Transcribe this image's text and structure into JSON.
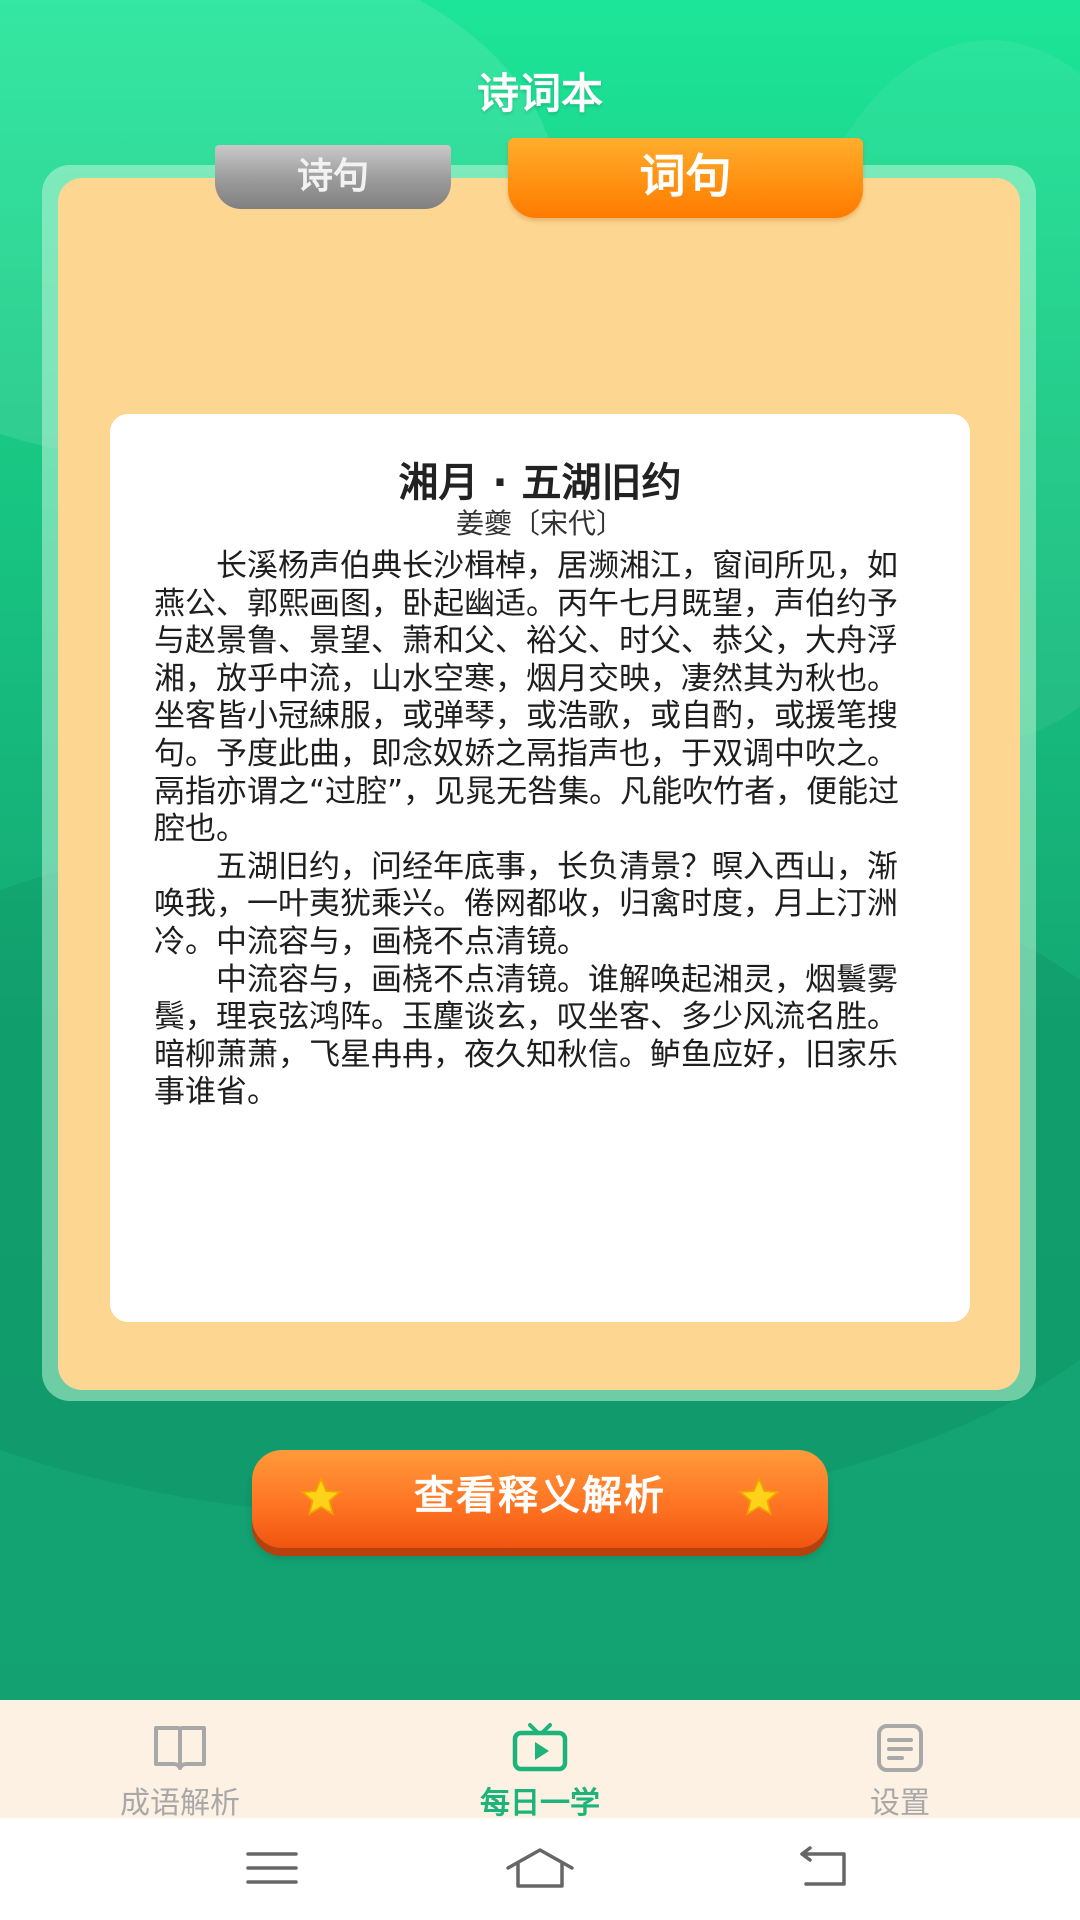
{
  "app": {
    "title": "诗词本"
  },
  "tabs": [
    {
      "label": "诗句",
      "active": false
    },
    {
      "label": "词句",
      "active": true
    }
  ],
  "poem": {
    "title": "湘月 · 五湖旧约",
    "author": "姜夔〔宋代〕",
    "paragraphs": [
      "长溪杨声伯典长沙楫棹，居濒湘江，窗间所见，如燕公、郭熙画图，卧起幽适。丙午七月既望，声伯约予与赵景鲁、景望、萧和父、裕父、时父、恭父，大舟浮湘，放乎中流，山水空寒，烟月交映，凄然其为秋也。坐客皆小冠綀服，或弹琴，或浩歌，或自酌，或援笔搜句。予度此曲，即念奴娇之鬲指声也，于双调中吹之。鬲指亦谓之“过腔”，见晁无咎集。凡能吹竹者，便能过腔也。",
      "五湖旧约，问经年底事，长负清景？暝入西山，渐唤我，一叶夷犹乘兴。倦网都收，归禽时度，月上汀洲冷。中流容与，画桡不点清镜。",
      "中流容与，画桡不点清镜。谁解唤起湘灵，烟鬟雾鬓，理哀弦鸿阵。玉麈谈玄，叹坐客、多少风流名胜。暗柳萧萧，飞星冉冉，夜久知秋信。鲈鱼应好，旧家乐事谁省。"
    ]
  },
  "action": {
    "label": "查看释义解析",
    "icon": "star-icon"
  },
  "bottom_nav": [
    {
      "label": "成语解析",
      "icon": "book-icon",
      "active": false
    },
    {
      "label": "每日一学",
      "icon": "tv-play-icon",
      "active": true
    },
    {
      "label": "设置",
      "icon": "document-icon",
      "active": false
    }
  ],
  "colors": {
    "primary_green": "#1cb47a",
    "tab_active": "#ff8f0f",
    "card_bg": "#fdd791",
    "action_button": "#ff7524"
  }
}
